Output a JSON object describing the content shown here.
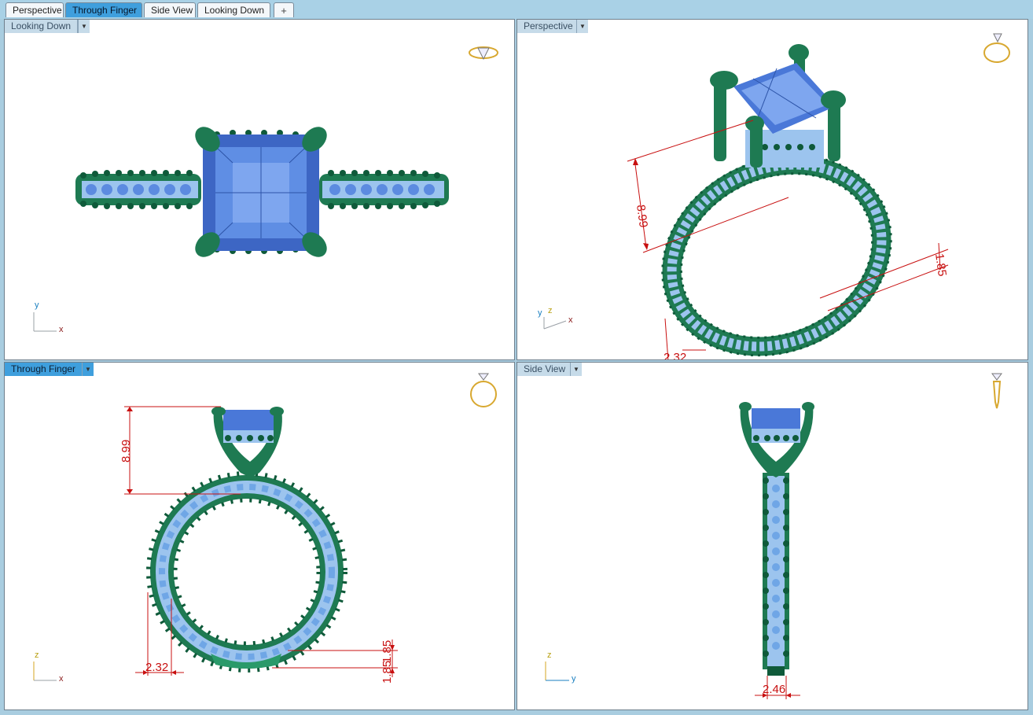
{
  "tabs": [
    {
      "label": "Perspective",
      "active": false
    },
    {
      "label": "Through Finger",
      "active": true
    },
    {
      "label": "Side View",
      "active": false
    },
    {
      "label": "Looking Down",
      "active": false
    }
  ],
  "tab_add_icon": "plus-icon",
  "viewports": {
    "top_left": {
      "title": "Looking Down",
      "active": false,
      "axes": {
        "h": "x",
        "v": "y"
      }
    },
    "top_right": {
      "title": "Perspective",
      "active": false,
      "axes": {
        "h": "x",
        "v": "y",
        "v2": "z"
      },
      "dims": {
        "height": "8.99",
        "width": "1.85",
        "shank": "2.32"
      }
    },
    "bottom_left": {
      "title": "Through Finger",
      "active": true,
      "axes": {
        "h": "x",
        "v": "z"
      },
      "dims": {
        "height": "8.99",
        "shank": "2.32",
        "thick_top": "1.85",
        "thick_bottom": "1.85"
      }
    },
    "bottom_right": {
      "title": "Side View",
      "active": false,
      "axes": {
        "h": "y",
        "v": "z"
      },
      "dims": {
        "width": "2.46"
      }
    }
  },
  "colors": {
    "metal": "#1e7a52",
    "metal_dark": "#0f5a3a",
    "stone": "#4a78d8",
    "stone_light": "#7ea6ef",
    "pave": "#9cc4ee",
    "dim": "#c81010",
    "active": "#3f9fdd"
  }
}
